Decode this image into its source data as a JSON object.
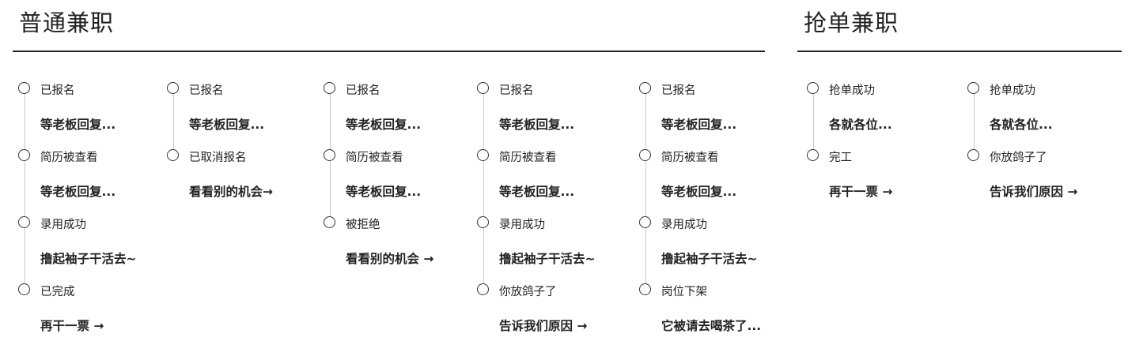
{
  "sections": [
    {
      "title": "普通兼职",
      "columns": [
        {
          "steps": [
            {
              "label": "已报名",
              "desc": "等老板回复..."
            },
            {
              "label": "简历被查看",
              "desc": "等老板回复..."
            },
            {
              "label": "录用成功",
              "desc": "撸起袖子干活去~"
            },
            {
              "label": "已完成",
              "desc": "再干一票 →"
            }
          ]
        },
        {
          "steps": [
            {
              "label": "已报名",
              "desc": "等老板回复..."
            },
            {
              "label": "已取消报名",
              "desc": "看看别的机会→"
            }
          ]
        },
        {
          "steps": [
            {
              "label": "已报名",
              "desc": "等老板回复..."
            },
            {
              "label": "简历被查看",
              "desc": "等老板回复..."
            },
            {
              "label": "被拒绝",
              "desc": "看看别的机会 →"
            }
          ]
        },
        {
          "steps": [
            {
              "label": "已报名",
              "desc": "等老板回复..."
            },
            {
              "label": "简历被查看",
              "desc": "等老板回复..."
            },
            {
              "label": "录用成功",
              "desc": "撸起袖子干活去~"
            },
            {
              "label": "你放鸽子了",
              "desc": "告诉我们原因 →"
            }
          ]
        },
        {
          "steps": [
            {
              "label": "已报名",
              "desc": "等老板回复..."
            },
            {
              "label": "简历被查看",
              "desc": "等老板回复..."
            },
            {
              "label": "录用成功",
              "desc": "撸起袖子干活去~"
            },
            {
              "label": "岗位下架",
              "desc": "它被请去喝茶了..."
            }
          ]
        }
      ]
    },
    {
      "title": "抢单兼职",
      "columns": [
        {
          "steps": [
            {
              "label": "抢单成功",
              "desc": "各就各位..."
            },
            {
              "label": "完工",
              "desc": "再干一票 →"
            }
          ]
        },
        {
          "steps": [
            {
              "label": "抢单成功",
              "desc": "各就各位..."
            },
            {
              "label": "你放鸽子了",
              "desc": "告诉我们原因 →"
            }
          ]
        }
      ]
    }
  ]
}
